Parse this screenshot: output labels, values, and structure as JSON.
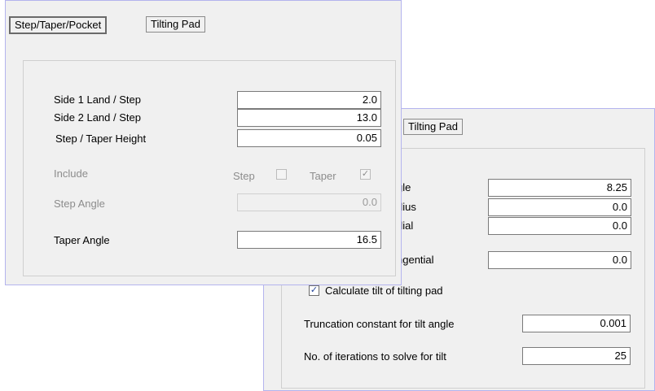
{
  "stray_chars": [
    "e",
    "s"
  ],
  "back_panel": {
    "tab_label": "Tilting Pad",
    "rows": [
      {
        "label": "gle",
        "value": "8.25"
      },
      {
        "label": "dius",
        "value": "0.0"
      },
      {
        "label": "dial",
        "value": "0.0"
      },
      {
        "label": "ngential",
        "value": "0.0"
      }
    ],
    "calc_tilt": {
      "label": "Calculate tilt of tilting pad",
      "checked": true
    },
    "truncation": {
      "label": "Truncation constant for tilt angle",
      "value": "0.001"
    },
    "iterations": {
      "label": "No. of iterations to solve for tilt",
      "value": "25"
    }
  },
  "front_panel": {
    "tabs": [
      {
        "label": "Step/Taper/Pocket",
        "active": true
      },
      {
        "label": "Tilting Pad",
        "active": false
      }
    ],
    "side1": {
      "label": "Side 1 Land / Step",
      "value": "2.0"
    },
    "side2": {
      "label": "Side 2 Land / Step",
      "value": "13.0"
    },
    "step_height": {
      "label": "Step / Taper Height",
      "value": "0.05"
    },
    "include": {
      "label": "Include",
      "step_label": "Step",
      "step_checked": false,
      "taper_label": "Taper",
      "taper_checked": true
    },
    "step_angle": {
      "label": "Step Angle",
      "value": "0.0"
    },
    "taper_angle": {
      "label": "Taper Angle",
      "value": "16.5"
    }
  }
}
